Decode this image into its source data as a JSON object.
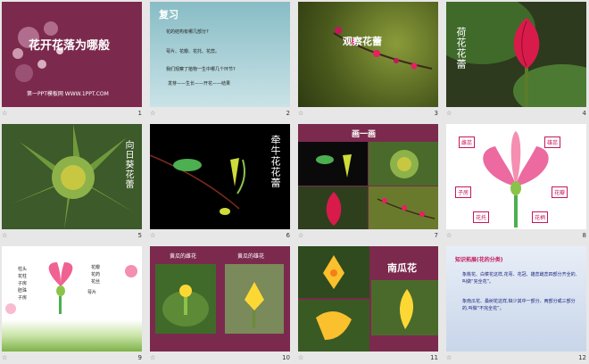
{
  "slides": [
    {
      "num": "1",
      "title": "花开花落为哪般",
      "footer": "第一PPT模板网 WWW.1PPT.COM"
    },
    {
      "num": "2",
      "heading": "复习",
      "lines": [
        "花的结构有哪几部分?",
        "萼片、花瓣、花托、花蕊。",
        "我们观察了植物一生中哪几个环节?",
        "发芽——生长——开花——结果"
      ]
    },
    {
      "num": "3",
      "title": "观察花蕾"
    },
    {
      "num": "4",
      "title": "荷花花蕾"
    },
    {
      "num": "5",
      "title": "向日葵花蕾"
    },
    {
      "num": "6",
      "title": "牵牛花花蕾"
    },
    {
      "num": "7",
      "title": "画一画"
    },
    {
      "num": "8",
      "labels": [
        "雌蕊",
        "雄蕊",
        "子房",
        "花瓣",
        "花托",
        "花柄"
      ]
    },
    {
      "num": "9",
      "labels_left": [
        "柱头",
        "花柱",
        "子房",
        "胚珠",
        "子房"
      ],
      "labels_right": [
        "花瓣",
        "花药",
        "花丝",
        "萼片"
      ]
    },
    {
      "num": "10",
      "caption_left": "黄瓜的雌花",
      "caption_right": "黄瓜的雄花"
    },
    {
      "num": "11",
      "title": "南瓜花"
    },
    {
      "num": "12",
      "heading": "知识拓展(花的分类)",
      "para1": "象桃花、白菜花这样,花萼、花冠、雄蕊雌蕊四部分齐全的,叫做“完全花”。",
      "para2": "象南瓜花、桑树花这样,缺少其中一部分、两部分或三部分的,叫做“不完全花”。"
    }
  ],
  "footer_star": "☆"
}
